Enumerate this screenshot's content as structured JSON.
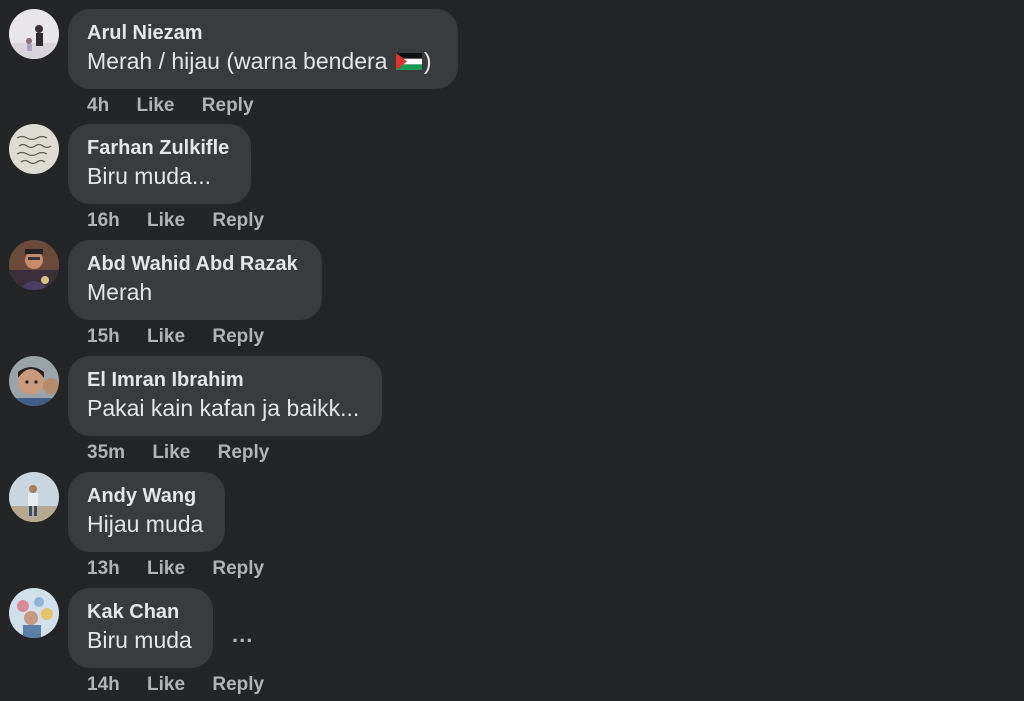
{
  "comments": [
    {
      "author": "Arul Niezam",
      "text": "Merah / hijau (warna bendera",
      "text_suffix": ")",
      "has_flag": true,
      "time": "4h",
      "like": "Like",
      "reply": "Reply"
    },
    {
      "author": "Farhan Zulkifle",
      "text": "Biru muda...",
      "time": "16h",
      "like": "Like",
      "reply": "Reply"
    },
    {
      "author": "Abd Wahid Abd Razak",
      "text": "Merah",
      "time": "15h",
      "like": "Like",
      "reply": "Reply"
    },
    {
      "author": "El Imran Ibrahim",
      "text": "Pakai kain kafan ja baikk...",
      "time": "35m",
      "like": "Like",
      "reply": "Reply"
    },
    {
      "author": "Andy Wang",
      "text": "Hijau muda",
      "time": "13h",
      "like": "Like",
      "reply": "Reply"
    },
    {
      "author": "Kak Chan",
      "text": "Biru muda",
      "time": "14h",
      "like": "Like",
      "reply": "Reply"
    }
  ],
  "more_options": "...",
  "colors": {
    "background": "#242526",
    "bubble": "#3a3b3c",
    "text": "#e4e6eb",
    "meta": "#b0b3b8"
  }
}
